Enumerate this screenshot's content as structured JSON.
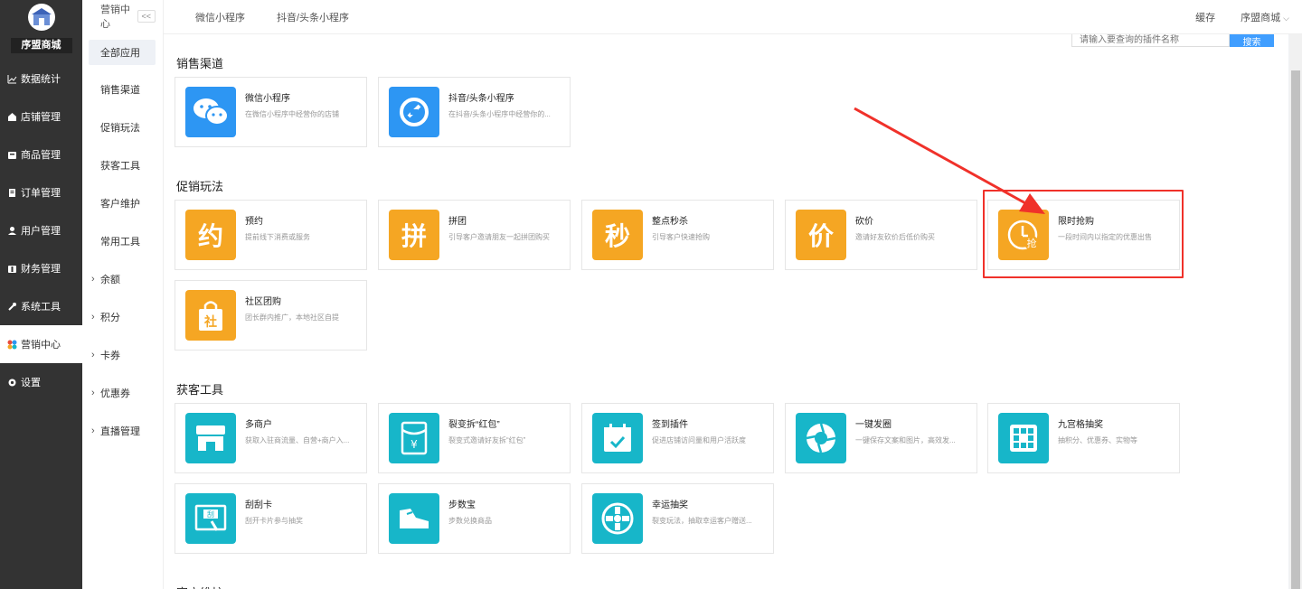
{
  "sidebar": {
    "logo_name": "序盟商城",
    "items": [
      {
        "label": "数据统计",
        "icon": "chart-icon"
      },
      {
        "label": "店铺管理",
        "icon": "shop-icon"
      },
      {
        "label": "商品管理",
        "icon": "goods-icon"
      },
      {
        "label": "订单管理",
        "icon": "order-icon"
      },
      {
        "label": "用户管理",
        "icon": "user-icon"
      },
      {
        "label": "财务管理",
        "icon": "finance-icon"
      },
      {
        "label": "系统工具",
        "icon": "wrench-icon"
      },
      {
        "label": "营销中心",
        "icon": "marketing-icon",
        "active": true
      },
      {
        "label": "设置",
        "icon": "gear-icon"
      }
    ]
  },
  "subbar": {
    "title": "营销中心",
    "collapse": "<<",
    "items": [
      "全部应用",
      "销售渠道",
      "促销玩法",
      "获客工具",
      "客户维护",
      "常用工具"
    ],
    "expandable": [
      "余额",
      "积分",
      "卡券",
      "优惠券",
      "直播管理"
    ]
  },
  "topbar": {
    "tabs": [
      "微信小程序",
      "抖音/头条小程序"
    ],
    "cache": "缓存",
    "shop": "序盟商城"
  },
  "search": {
    "placeholder": "请输入要查询的插件名称",
    "button": "搜索"
  },
  "sections": [
    {
      "title": "销售渠道",
      "cards": [
        {
          "name": "微信小程序",
          "desc": "在微信小程序中经营你的店铺",
          "icon": "wechat-icon",
          "color": "blue"
        },
        {
          "name": "抖音/头条小程序",
          "desc": "在抖音/头条小程序中经营你的...",
          "icon": "douyin-icon",
          "color": "blue"
        }
      ]
    },
    {
      "title": "促销玩法",
      "cards": [
        {
          "name": "预约",
          "desc": "提前线下消费或服务",
          "icon": "yue-icon",
          "color": "orange",
          "glyph": "约"
        },
        {
          "name": "拼团",
          "desc": "引导客户邀请朋友一起拼团购买",
          "icon": "pintuan-icon",
          "color": "orange",
          "glyph": "拼"
        },
        {
          "name": "整点秒杀",
          "desc": "引导客户快速抢购",
          "icon": "miao-icon",
          "color": "orange",
          "glyph": "秒"
        },
        {
          "name": "砍价",
          "desc": "邀请好友砍价后低价购买",
          "icon": "kanjia-icon",
          "color": "orange",
          "glyph": "价"
        },
        {
          "name": "限时抢购",
          "desc": "一段时间内以指定的优惠出售",
          "icon": "clock-icon",
          "color": "orange",
          "glyph": "抢"
        },
        {
          "name": "社区团购",
          "desc": "团长群内推广，本地社区自提",
          "icon": "bag-icon",
          "color": "orange",
          "glyph": "社"
        }
      ]
    },
    {
      "title": "获客工具",
      "cards": [
        {
          "name": "多商户",
          "desc": "获取入驻商流量、自营+商户入...",
          "icon": "store-icon",
          "color": "teal"
        },
        {
          "name": "裂变拆“红包”",
          "desc": "裂变式邀请好友拆“红包”",
          "icon": "redpacket-icon",
          "color": "teal"
        },
        {
          "name": "签到插件",
          "desc": "促进店铺访问量和用户活跃度",
          "icon": "calendar-icon",
          "color": "teal"
        },
        {
          "name": "一键发圈",
          "desc": "一键保存文案和图片，高效发...",
          "icon": "aperture-icon",
          "color": "teal"
        },
        {
          "name": "九宫格抽奖",
          "desc": "抽积分、优惠券、实物等",
          "icon": "grid-icon",
          "color": "teal"
        },
        {
          "name": "刮刮卡",
          "desc": "刮开卡片参与抽奖",
          "icon": "scratch-icon",
          "color": "teal",
          "glyph": "刮"
        },
        {
          "name": "步数宝",
          "desc": "步数兑换商品",
          "icon": "shoe-icon",
          "color": "teal"
        },
        {
          "name": "幸运抽奖",
          "desc": "裂变玩法，抽取幸运客户赠送...",
          "icon": "wheel-icon",
          "color": "teal"
        }
      ]
    },
    {
      "title": "客户维护",
      "cards": []
    }
  ],
  "colors": {
    "blue": "#2d96f3",
    "orange": "#f5a623",
    "teal": "#17b6c9",
    "highlight": "#f0312a"
  }
}
